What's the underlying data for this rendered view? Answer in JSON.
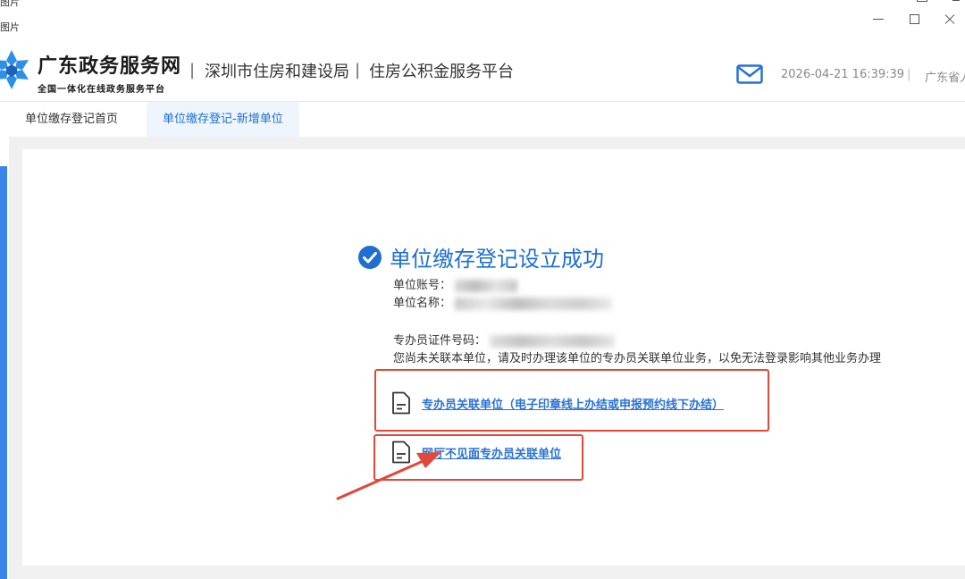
{
  "window": {
    "frag_a": "图片",
    "frag_b": "图片"
  },
  "header": {
    "brand_title": "广东政务服务网",
    "brand_subtitle": "全国一体化在线政务服务平台",
    "separator": "|",
    "department": "深圳市住房和建设局",
    "platform": "住房公积金服务平台",
    "datetime": "2026-04-21 16:39:39",
    "region": "广东省人"
  },
  "tabs": [
    {
      "label": "单位缴存登记首页"
    },
    {
      "label": "单位缴存登记-新增单位"
    }
  ],
  "result": {
    "title": "单位缴存登记设立成功",
    "account_label": "单位账号：",
    "name_label": "单位名称：",
    "id_label": "专办员证件号码：",
    "notice": "您尚未关联本单位，请及时办理该单位的专办员关联单位业务，以免无法登录影响其他业务办理"
  },
  "links": {
    "link1": "专办员关联单位（电子印章线上办结或申报预约线下办结）",
    "link2": "网厅不见面专办员关联单位"
  },
  "colors": {
    "primary": "#1e6fd0",
    "annotation": "#e0483a",
    "link": "#2a72d4"
  },
  "icons": {
    "mail": "mail-icon",
    "check": "check-circle-icon",
    "document": "document-icon",
    "logo": "snowflake-logo-icon"
  }
}
